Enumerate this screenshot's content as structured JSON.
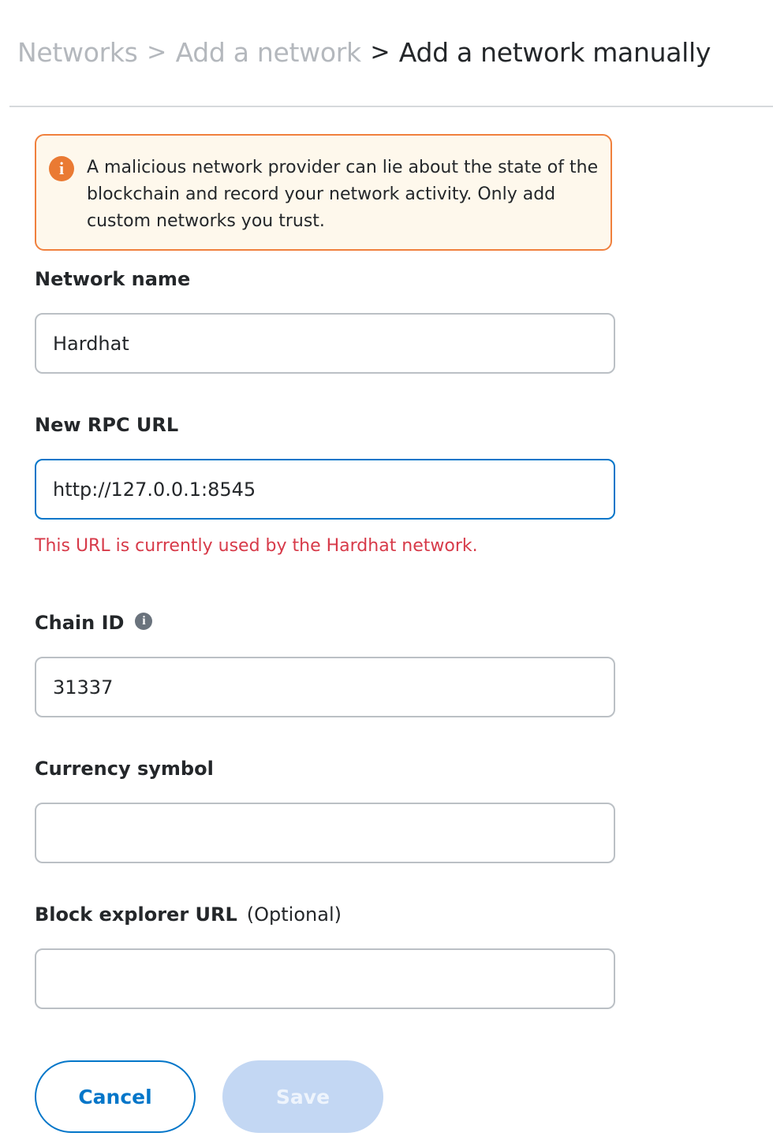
{
  "breadcrumb": {
    "items": [
      "Networks",
      "Add a network",
      "Add a network manually"
    ],
    "separator": ">"
  },
  "warning": {
    "icon": "info-icon",
    "text": "A malicious network provider can lie about the state of the blockchain and record your network activity. Only add custom networks you trust."
  },
  "form": {
    "network_name": {
      "label": "Network name",
      "value": "Hardhat"
    },
    "rpc_url": {
      "label": "New RPC URL",
      "value": "http://127.0.0.1:8545",
      "error": "This URL is currently used by the Hardhat network."
    },
    "chain_id": {
      "label": "Chain ID",
      "info_icon": "info-icon",
      "value": "31337"
    },
    "currency_symbol": {
      "label": "Currency symbol",
      "value": ""
    },
    "block_explorer": {
      "label": "Block explorer URL",
      "optional_label": "(Optional)",
      "value": ""
    }
  },
  "buttons": {
    "cancel_label": "Cancel",
    "save_label": "Save",
    "save_disabled": true
  },
  "colors": {
    "primary": "#0376c9",
    "warning_border": "#f0803d",
    "warning_bg": "#fef8ec",
    "error": "#d73a49",
    "disabled_button": "#c3d7f3"
  }
}
